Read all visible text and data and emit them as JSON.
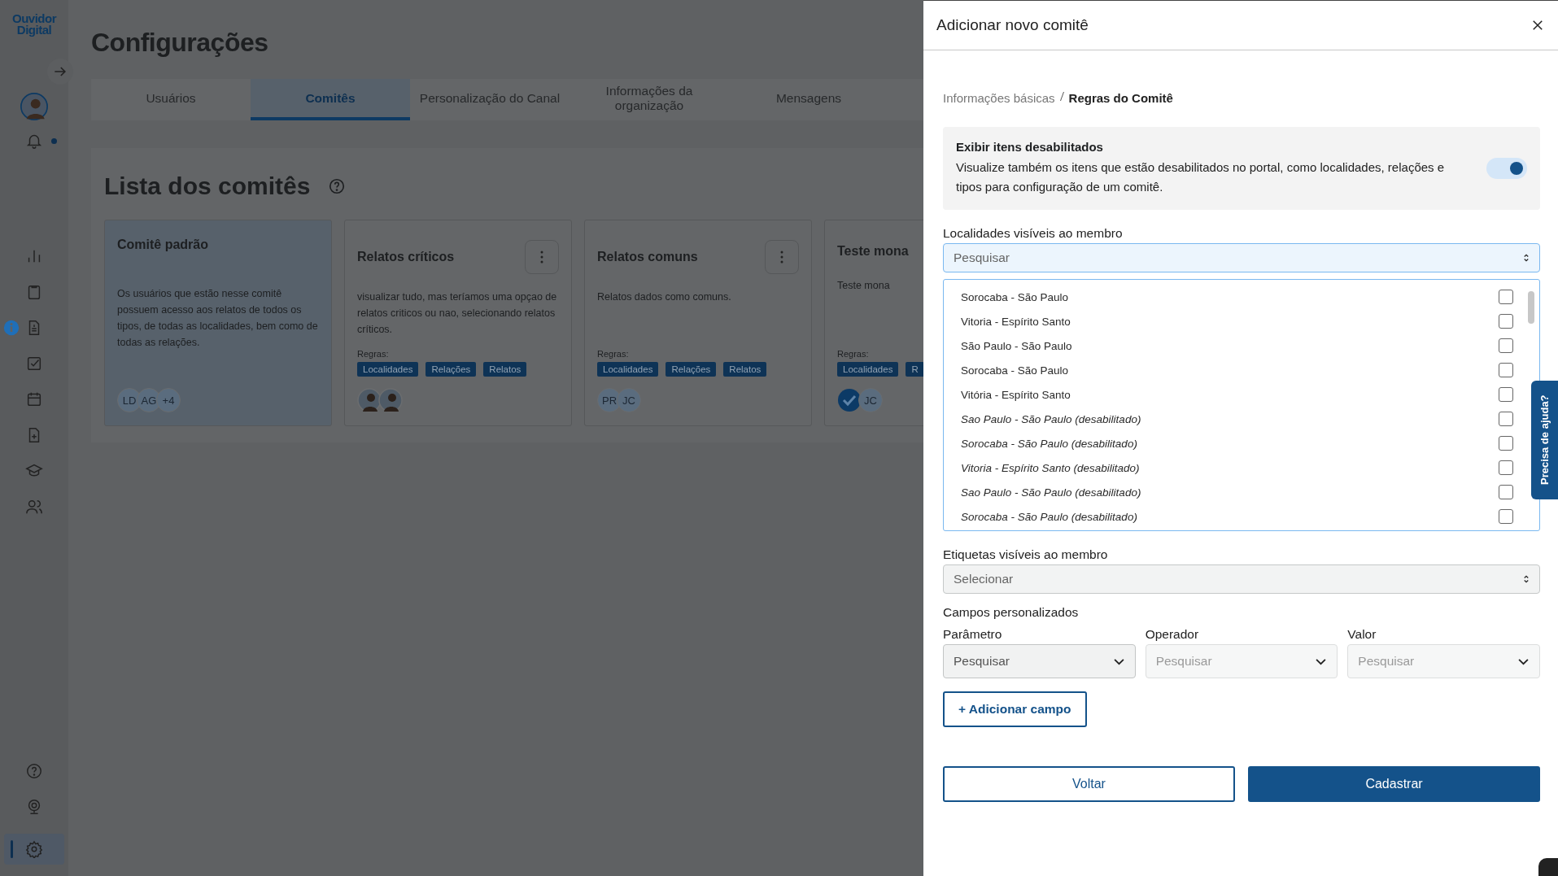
{
  "sidebar": {
    "logo_lines": [
      "Ouvidor",
      "Digital"
    ],
    "notification_unread": true,
    "nav": [
      {
        "selected": false,
        "info": false
      },
      {
        "selected": false,
        "info": false
      },
      {
        "selected": false,
        "info": true
      },
      {
        "selected": false,
        "info": false
      },
      {
        "selected": false,
        "info": false
      },
      {
        "selected": false,
        "info": false
      },
      {
        "selected": false,
        "info": false
      },
      {
        "selected": false,
        "info": false
      }
    ],
    "bottom_nav": [
      {
        "selected": false
      },
      {
        "selected": false
      },
      {
        "selected": true
      }
    ]
  },
  "page_title": "Configurações",
  "tabs": [
    {
      "label": "Usuários",
      "selected": false
    },
    {
      "label": "Comitês",
      "selected": true
    },
    {
      "label": "Personalização do Canal",
      "selected": false
    },
    {
      "label": "Informações da organização",
      "selected": false
    },
    {
      "label": "Mensagens",
      "selected": false
    }
  ],
  "list_title": "Lista dos comitês",
  "cards": [
    {
      "title": "Comitê padrão",
      "selected": true,
      "menu": false,
      "description": "Os usuários que estão nesse comitê possuem acesso aos relatos de todos os tipos, de todas as localidades, bem como de todas as relações.",
      "members": [
        {
          "kind": "initials",
          "text": "LD"
        },
        {
          "kind": "initials",
          "text": "AG"
        },
        {
          "kind": "initials",
          "text": "+4"
        }
      ]
    },
    {
      "title": "Relatos críticos",
      "selected": false,
      "menu": true,
      "description": "visualizar tudo, mas teríamos uma opçao de relatos criticos ou nao, selecionando relatos críticos.",
      "rules_label": "Regras:",
      "tags": [
        "Localidades",
        "Relações",
        "Relatos"
      ],
      "members": [
        {
          "kind": "photo"
        },
        {
          "kind": "photo"
        }
      ]
    },
    {
      "title": "Relatos comuns",
      "selected": false,
      "menu": true,
      "description": "Relatos dados como comuns.",
      "rules_label": "Regras:",
      "tags": [
        "Localidades",
        "Relações",
        "Relatos"
      ],
      "members": [
        {
          "kind": "initials",
          "text": "PR"
        },
        {
          "kind": "initials",
          "text": "JC"
        }
      ]
    },
    {
      "title": "Teste mona",
      "selected": false,
      "menu": false,
      "description": "Teste mona",
      "rules_label": "Regras:",
      "tags": [
        "Localidades",
        "R"
      ],
      "members": [
        {
          "kind": "logo"
        },
        {
          "kind": "initials",
          "text": "JC"
        }
      ]
    }
  ],
  "drawer": {
    "title": "Adicionar novo comitê",
    "breadcrumb": [
      {
        "label": "Informações básicas",
        "selected": false
      },
      {
        "label": "Regras do Comitê",
        "selected": true
      }
    ],
    "option": {
      "title": "Exibir itens desabilitados",
      "text": "Visualize também os itens que estão desabilitados no portal, como localidades, relações e tipos para configuração de um comitê.",
      "on": true
    },
    "locations": {
      "label": "Localidades visíveis ao membro",
      "placeholder": "Pesquisar",
      "items": [
        {
          "label": "Sorocaba - São Paulo",
          "disabled": false,
          "checked": false
        },
        {
          "label": "Vitoria - Espírito Santo",
          "disabled": false,
          "checked": false
        },
        {
          "label": "São Paulo - São Paulo",
          "disabled": false,
          "checked": false
        },
        {
          "label": "Sorocaba - São Paulo",
          "disabled": false,
          "checked": false
        },
        {
          "label": "Vitória - Espírito Santo",
          "disabled": false,
          "checked": false
        },
        {
          "label": "Sao Paulo - São Paulo (desabilitado)",
          "disabled": true,
          "checked": false
        },
        {
          "label": "Sorocaba - São Paulo (desabilitado)",
          "disabled": true,
          "checked": false
        },
        {
          "label": "Vitoria - Espírito Santo (desabilitado)",
          "disabled": true,
          "checked": false
        },
        {
          "label": "Sao Paulo - São Paulo (desabilitado)",
          "disabled": true,
          "checked": false
        },
        {
          "label": "Sorocaba - São Paulo (desabilitado)",
          "disabled": true,
          "checked": false
        }
      ]
    },
    "tags_field": {
      "label": "Etiquetas visíveis ao membro",
      "placeholder": "Selecionar"
    },
    "custom_fields": {
      "title": "Campos personalizados",
      "fields": [
        {
          "label": "Parâmetro",
          "placeholder": "Pesquisar",
          "disabled": false
        },
        {
          "label": "Operador",
          "placeholder": "Pesquisar",
          "disabled": true
        },
        {
          "label": "Valor",
          "placeholder": "Pesquisar",
          "disabled": true
        }
      ],
      "add_button": "+ Adicionar campo"
    },
    "buttons": [
      {
        "label": "Voltar",
        "kind": "secondary"
      },
      {
        "label": "Cadastrar",
        "kind": "primary"
      }
    ]
  },
  "help_tab": "Precisa de ajuda?"
}
